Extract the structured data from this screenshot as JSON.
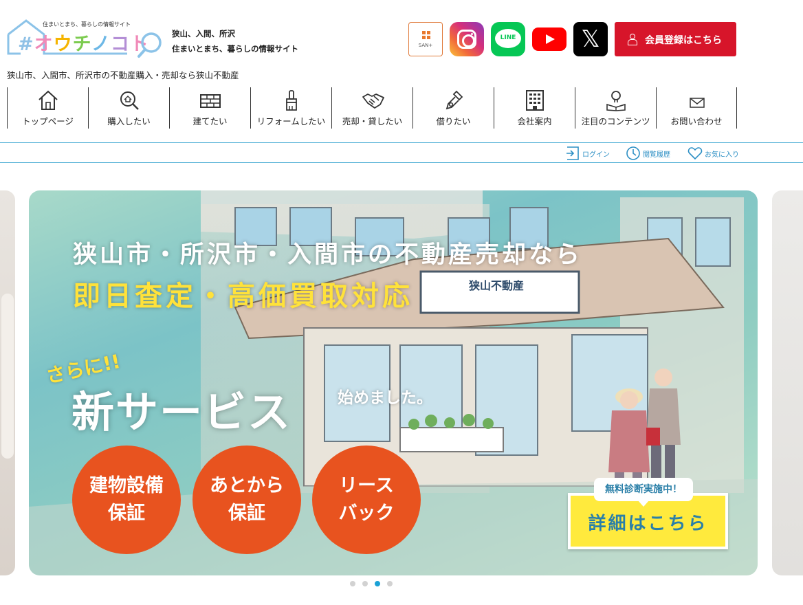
{
  "logo": {
    "tagline": "住まいとまち、暮らしの情報サイト",
    "hash": "#",
    "chars": [
      "オ",
      "ウ",
      "チ",
      "ノ",
      "コ",
      "ト"
    ]
  },
  "site_description": {
    "line1": "狭山、入間、所沢",
    "line2": "住まいとまち、暮らしの情報サイト"
  },
  "header_buttons": {
    "sanplus_label": "SAN+",
    "line_label": "LINE",
    "x_label": "𝕏",
    "member_label": "会員登録はこちら"
  },
  "tagline": "狭山市、入間市、所沢市の不動産購入・売却なら狭山不動産",
  "nav": {
    "items": [
      {
        "label": "トップページ",
        "icon": "home-icon"
      },
      {
        "label": "購入したい",
        "icon": "search-house-icon"
      },
      {
        "label": "建てたい",
        "icon": "brick-icon"
      },
      {
        "label": "リフォームしたい",
        "icon": "paint-brush-icon"
      },
      {
        "label": "売却・貸したい",
        "icon": "handshake-icon"
      },
      {
        "label": "借りたい",
        "icon": "key-icon"
      },
      {
        "label": "会社案内",
        "icon": "building-icon"
      },
      {
        "label": "注目のコンテンツ",
        "icon": "lightbulb-book-icon"
      },
      {
        "label": "お問い合わせ",
        "icon": "mail-icon"
      }
    ]
  },
  "util": {
    "login": "ログイン",
    "history": "閲覧履歴",
    "favorites": "お気に入り"
  },
  "slide": {
    "headline1": "狭山市・所沢市・入間市の不動産売却なら",
    "headline2": "即日査定・高価買取対応",
    "sarani": "さらに!!",
    "new_service": "新サービス",
    "started": "始めました。",
    "shop_sign": "狭山不動産",
    "circles": [
      {
        "line1": "建物設備",
        "line2": "保証"
      },
      {
        "line1": "あとから",
        "line2": "保証"
      },
      {
        "line1": "リース",
        "line2": "バック"
      }
    ],
    "free_badge": "無料診断実施中！",
    "detail_button": "詳細はこちら"
  },
  "slider": {
    "total": 4,
    "active_index": 2
  },
  "colors": {
    "member_button": "#d7152a",
    "accent_blue": "#1aa1d6",
    "circle_orange": "#e8531f",
    "headline_yellow": "#ffe23a"
  }
}
